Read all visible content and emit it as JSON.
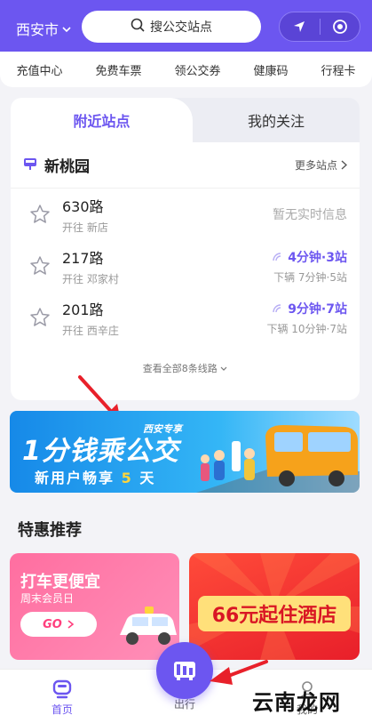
{
  "header": {
    "city": "西安市",
    "search_label": "搜公交站点"
  },
  "quick_links": [
    "充值中心",
    "免费车票",
    "领公交券",
    "健康码",
    "行程卡"
  ],
  "nearby": {
    "tab_active": "附近站点",
    "tab_other": "我的关注",
    "stop_name": "新桃园",
    "more_label": "更多站点",
    "routes": [
      {
        "number": "630路",
        "direction": "开往 新店",
        "status": "暂无实时信息"
      },
      {
        "number": "217路",
        "direction": "开往 邓家村",
        "eta": "4分钟·3站",
        "next": "下辆 7分钟·5站"
      },
      {
        "number": "201路",
        "direction": "开往 西辛庄",
        "eta": "9分钟·7站",
        "next": "下辆 10分钟·7站"
      }
    ],
    "see_all": "查看全部8条线路"
  },
  "banner": {
    "brand": "西安专享",
    "title": "1分钱乘公交",
    "subtitle_a": "新用户畅享",
    "subtitle_num": "5",
    "subtitle_b": "天"
  },
  "promos": {
    "section_title": "特惠推荐",
    "left_title": "打车更便宜",
    "left_sub": "周末会员日",
    "left_go": "GO",
    "right_title": "66元起住酒店"
  },
  "tabbar": {
    "home": "首页",
    "travel": "出行",
    "mine": "我的"
  },
  "watermark": "云南龙网",
  "colors": {
    "brand": "#6c56f0",
    "eta": "#6c56f0",
    "arrow": "#e8202a"
  }
}
